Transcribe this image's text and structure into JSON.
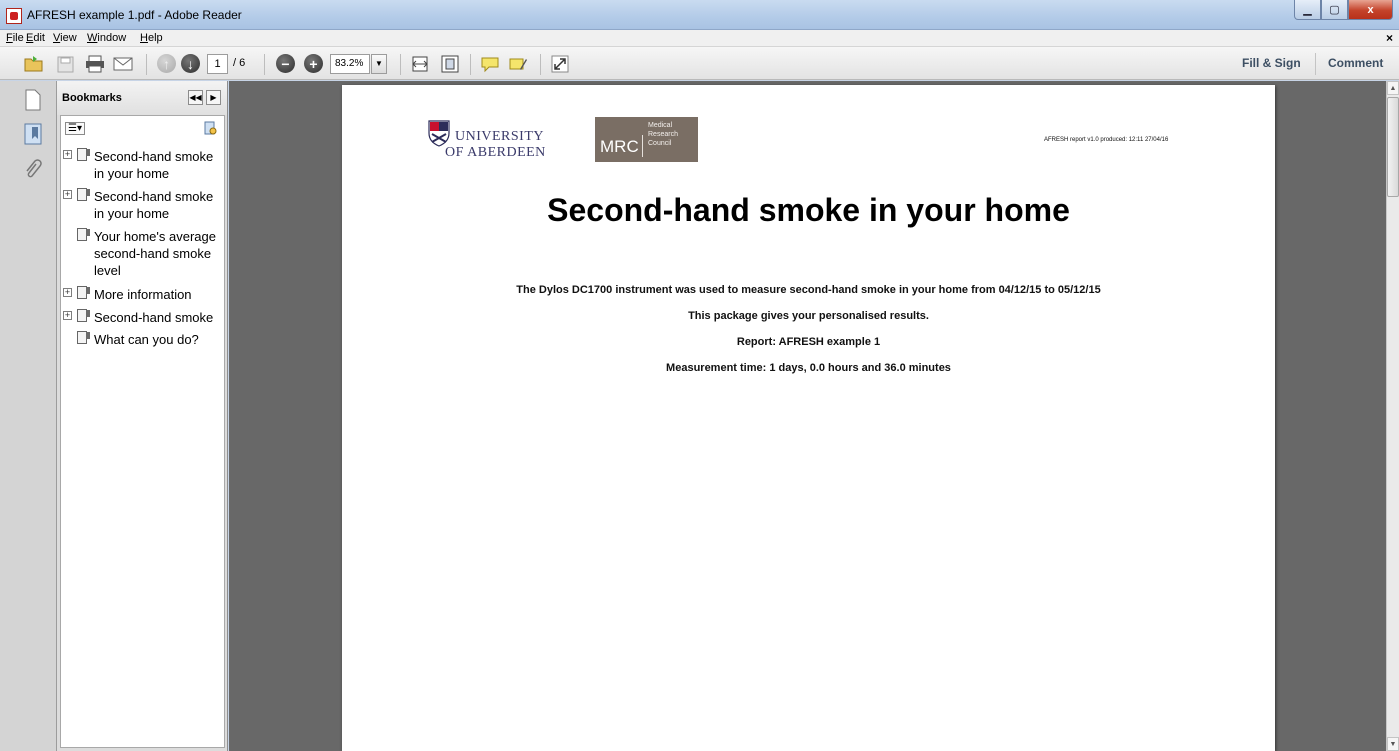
{
  "window": {
    "title": "AFRESH example 1.pdf - Adobe Reader",
    "controls": {
      "minimize": "▁",
      "maximize": "▢",
      "close": "x"
    }
  },
  "menu": {
    "items": [
      "File",
      "Edit",
      "View",
      "Window",
      "Help"
    ],
    "close_doc": "×"
  },
  "toolbar": {
    "current_page": "1",
    "page_total": "/ 6",
    "zoom": "83.2%",
    "fill_sign": "Fill & Sign",
    "comment": "Comment"
  },
  "bookmarks": {
    "title": "Bookmarks",
    "items": [
      {
        "label": "Second-hand smoke in your home",
        "expandable": true
      },
      {
        "label": "Second-hand smoke in your home",
        "expandable": true
      },
      {
        "label": "Your home's average second-hand smoke level",
        "expandable": false
      },
      {
        "label": "More information",
        "expandable": true
      },
      {
        "label": "Second-hand smoke",
        "expandable": true
      },
      {
        "label": "What can you do?",
        "expandable": false
      }
    ]
  },
  "document": {
    "logo_uni_line1": "UNIVERSITY",
    "logo_uni_line2": "OF ABERDEEN",
    "logo_mrc": "MRC",
    "logo_mrc_sub1": "Medical",
    "logo_mrc_sub2": "Research",
    "logo_mrc_sub3": "Council",
    "produced": "AFRESH report v1.0 produced: 12:11 27/04/16",
    "title": "Second-hand smoke in your home",
    "line1": "The Dylos DC1700 instrument was used to measure second-hand smoke in your home from 04/12/15 to 05/12/15",
    "line2": "This package gives your personalised results.",
    "line3": "Report: AFRESH example 1",
    "line4": "Measurement time: 1 days, 0.0 hours and 36.0 minutes"
  },
  "colors": {
    "mrc_brand": "#7a6e64",
    "aberdeen_blue": "#3a3a6a",
    "toolbar_link": "#3d4f63"
  }
}
